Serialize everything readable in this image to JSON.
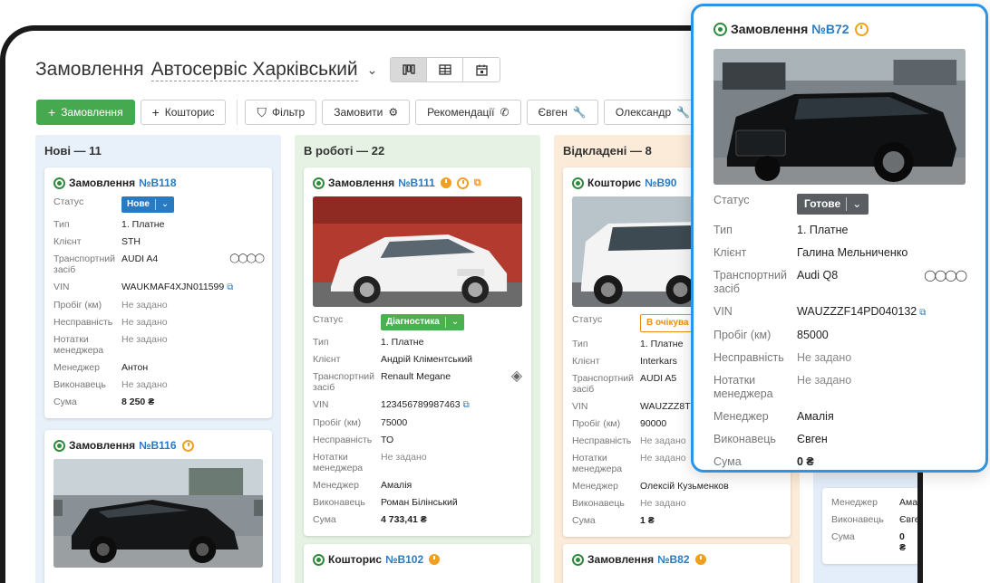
{
  "header": {
    "title": "Замовлення",
    "company": "Автосервіс Харківський",
    "views": [
      "kanban-icon",
      "table-icon",
      "calendar-icon"
    ]
  },
  "toolbar": {
    "add_order": "Замовлення",
    "add_estimate": "Кошторис",
    "filter": "Фільтр",
    "order": "Замовити",
    "recommend": "Рекомендації",
    "evgen": "Євген",
    "oleksandr": "Олександр"
  },
  "columns": [
    {
      "title": "Нові — 11"
    },
    {
      "title": "В роботі — 22"
    },
    {
      "title": "Відкладені — 8"
    }
  ],
  "labels": {
    "status": "Статус",
    "type": "Тип",
    "client": "Клієнт",
    "vehicle": "Транспортний засіб",
    "vin": "VIN",
    "mileage": "Пробіг (км)",
    "fault": "Несправність",
    "notes": "Нотатки менеджера",
    "manager": "Менеджер",
    "executor": "Виконавець",
    "sum": "Сума"
  },
  "cards": {
    "b118": {
      "kind": "Замовлення",
      "number": "№В118",
      "status": "Нове",
      "type": "1. Платне",
      "client": "STH",
      "vehicle": "AUDI A4",
      "vin": "WAUKMAF4XJN011599",
      "mileage": "Не задано",
      "fault": "Не задано",
      "notes": "Не задано",
      "manager": "Антон",
      "executor": "Не задано",
      "sum": "8 250 ₴"
    },
    "b116": {
      "kind": "Замовлення",
      "number": "№В116"
    },
    "b111": {
      "kind": "Замовлення",
      "number": "№В111",
      "status": "Діагностика",
      "type": "1. Платне",
      "client": "Андрій Кліментський",
      "vehicle": "Renault Megane",
      "vin": "123456789987463",
      "mileage": "75000",
      "fault": "ТО",
      "notes": "Не задано",
      "manager": "Амалія",
      "executor": "Роман Білінський",
      "sum": "4 733,41 ₴"
    },
    "b102": {
      "kind": "Кошторис",
      "number": "№В102"
    },
    "b90": {
      "kind": "Кошторис",
      "number": "№В90",
      "status": "В очікува",
      "type": "1. Платне",
      "client": "Interkars",
      "vehicle": "AUDI A5",
      "vin": "WAUZZZ8T1",
      "mileage": "90000",
      "fault": "Не задано",
      "notes": "Не задано",
      "manager": "Олексій Кузьменков",
      "executor": "Не задано",
      "sum": "1 ₴"
    },
    "b82": {
      "kind": "Замовлення",
      "number": "№В82"
    },
    "next": {
      "manager": "Амал",
      "executor": "Євге",
      "sum": "0 ₴"
    }
  },
  "popup": {
    "kind": "Замовлення",
    "number": "№В72",
    "status": "Готове",
    "type": "1. Платне",
    "client": "Галина Мельниченко",
    "vehicle": "Audi Q8",
    "vin": "WAUZZZF14PD040132",
    "mileage": "85000",
    "fault": "Не задано",
    "notes": "Не задано",
    "manager": "Амалія",
    "executor": "Євген",
    "sum": "0 ₴"
  },
  "colors": {
    "accent_green": "#46a84f",
    "link_blue": "#2a7ac2",
    "popup_border": "#2a95e8",
    "clock_orange": "#f0a020"
  }
}
